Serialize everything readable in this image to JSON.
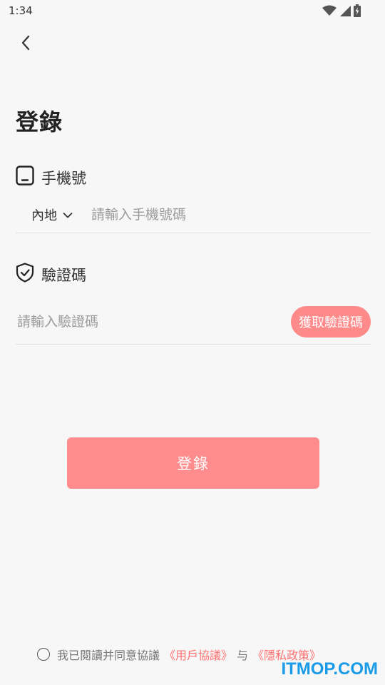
{
  "status_bar": {
    "time": "1:34",
    "icons": [
      "wifi-icon",
      "signal-icon",
      "battery-icon"
    ]
  },
  "header": {
    "back_icon": "chevron-left-icon",
    "title": "登錄"
  },
  "phone": {
    "label": "手機號",
    "icon": "phone-icon",
    "region": "內地",
    "region_icon": "chevron-down-icon",
    "placeholder": "請輸入手機號碼",
    "value": ""
  },
  "code": {
    "label": "驗證碼",
    "icon": "shield-check-icon",
    "placeholder": "請輸入驗證碼",
    "value": "",
    "get_code_label": "獲取驗證碼"
  },
  "login_button": {
    "label": "登錄"
  },
  "agreement": {
    "prefix": "我已閱讀并同意協議",
    "user_agreement": "《用戶協議》",
    "and": "与",
    "privacy_policy": "《隱私政策》"
  },
  "watermark": "ITMOP.COM",
  "colors": {
    "accent": "#ff8a8a",
    "link": "#ff7070",
    "background": "#f7f7f7",
    "watermark": "#1a9be8"
  }
}
